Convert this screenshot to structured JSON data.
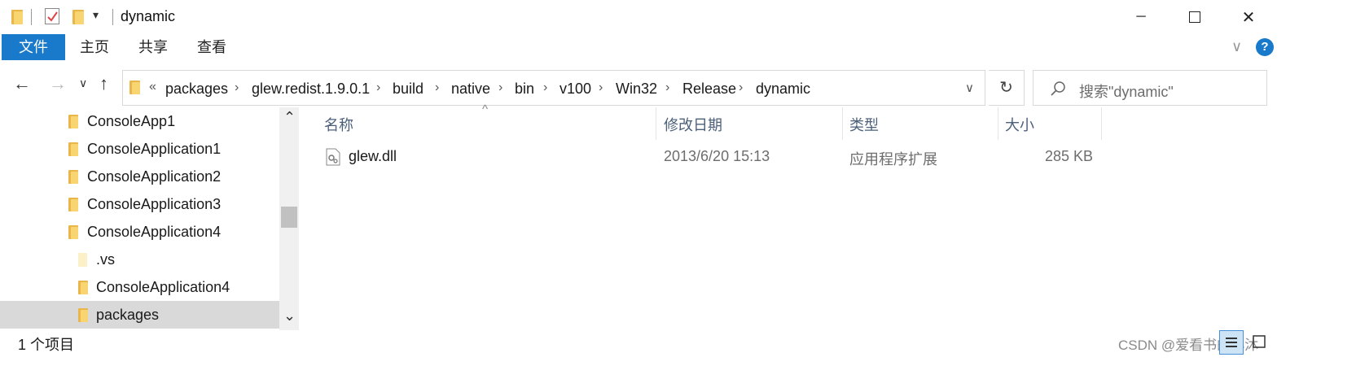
{
  "window": {
    "title": "dynamic",
    "minimize_glyph": "─",
    "maximize_glyph": "☐",
    "close_glyph": "✕",
    "qa_dropdown_glyph": "▾"
  },
  "ribbon": {
    "tabs": [
      "文件",
      "主页",
      "共享",
      "查看"
    ],
    "collapse_glyph": "∨",
    "help_glyph": "?"
  },
  "nav": {
    "back_glyph": "←",
    "forward_glyph": "→",
    "recent_glyph": "∨",
    "up_glyph": "↑",
    "overflow": "«",
    "breadcrumbs": [
      "packages",
      "glew.redist.1.9.0.1",
      "build",
      "native",
      "bin",
      "v100",
      "Win32",
      "Release",
      "dynamic"
    ],
    "breadcrumb_sep": "›",
    "dropdown_glyph": "∨",
    "refresh_glyph": "↻",
    "search_placeholder": "搜索\"dynamic\""
  },
  "tree": {
    "items": [
      {
        "label": "ConsoleApp1"
      },
      {
        "label": "ConsoleApplication1"
      },
      {
        "label": "ConsoleApplication2"
      },
      {
        "label": "ConsoleApplication3"
      },
      {
        "label": "ConsoleApplication4"
      },
      {
        "label": ".vs"
      },
      {
        "label": "ConsoleApplication4"
      },
      {
        "label": "packages"
      }
    ],
    "scroll_up_glyph": "⌃",
    "scroll_down_glyph": "⌄"
  },
  "table": {
    "sort_glyph": "^",
    "columns": [
      "名称",
      "修改日期",
      "类型",
      "大小"
    ],
    "rows": [
      {
        "name": "glew.dll",
        "modified": "2013/6/20 15:13",
        "type": "应用程序扩展",
        "size": "285 KB"
      }
    ]
  },
  "status": {
    "item_count": "1 个项目",
    "watermark": "CSDN @爱看书的小沐"
  },
  "colors": {
    "accent": "#1979ca",
    "folder": "#f9d571",
    "selection": "#d9d9d9"
  }
}
